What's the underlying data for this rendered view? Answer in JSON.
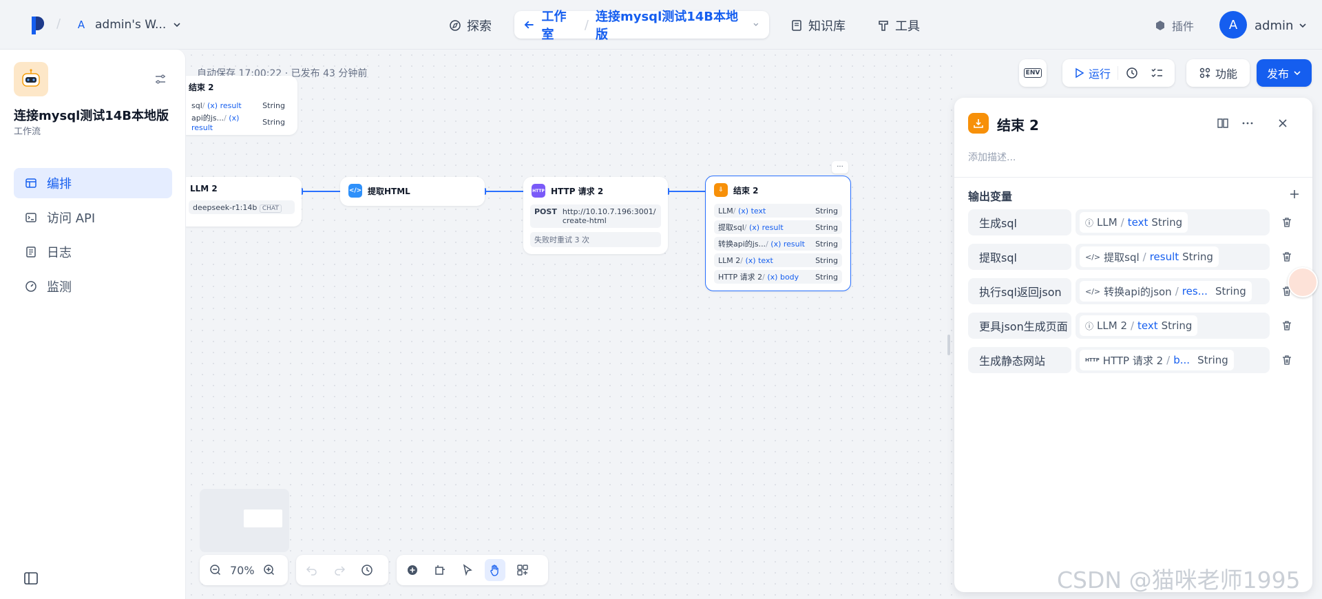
{
  "topbar": {
    "workspace_badge": "A",
    "workspace_name": "admin's W...",
    "explore": "探索",
    "studio": "工作室",
    "app_name": "连接mysql测试14B本地版",
    "knowledge": "知识库",
    "tools": "工具",
    "plugins": "插件",
    "avatar_letter": "A",
    "user": "admin"
  },
  "sidebar": {
    "app_title": "连接mysql测试14B本地版",
    "app_type": "工作流",
    "items": [
      {
        "label": "编排",
        "icon": "layout-icon"
      },
      {
        "label": "访问 API",
        "icon": "terminal-icon"
      },
      {
        "label": "日志",
        "icon": "file-list-icon"
      },
      {
        "label": "监测",
        "icon": "gauge-icon"
      }
    ]
  },
  "canvas": {
    "autosave": "自动保存 17:00:22 · 已发布 43 分钟前",
    "zoom": "70%",
    "node_end_partial": {
      "title": "结束 2",
      "rows": [
        {
          "src": "sql",
          "var": "result",
          "type": "String"
        },
        {
          "src": "api的js...",
          "var": "result",
          "type": "String"
        }
      ]
    },
    "node_llm": {
      "title": "LLM 2",
      "model": "deepseek-r1:14b",
      "tag": "CHAT"
    },
    "node_extract": {
      "title": "提取HTML"
    },
    "node_http": {
      "icon": "HTTP",
      "title": "HTTP 请求 2",
      "method": "POST",
      "url": "http://10.10.7.196:3001/create-html",
      "retry": "失败时重试 3 次"
    },
    "node_end": {
      "title": "结束 2",
      "more": "···",
      "rows": [
        {
          "src": "LLM",
          "var": "text",
          "type": "String"
        },
        {
          "src": "提取sql",
          "var": "result",
          "type": "String"
        },
        {
          "src": "转换api的js...",
          "var": "result",
          "type": "String"
        },
        {
          "src": "LLM 2",
          "var": "text",
          "type": "String"
        },
        {
          "src": "HTTP 请求 2",
          "var": "body",
          "type": "String"
        }
      ]
    }
  },
  "actions": {
    "env": "ENV",
    "run": "运行",
    "features": "功能",
    "publish": "发布"
  },
  "panel": {
    "title": "结束 2",
    "desc_placeholder": "添加描述...",
    "outputs_title": "输出变量",
    "outputs": [
      {
        "name": "生成sql",
        "src": "LLM",
        "var": "text",
        "type": "String"
      },
      {
        "name": "提取sql",
        "src": "提取sql",
        "var": "result",
        "type": "String"
      },
      {
        "name": "执行sql返回json",
        "src": "转换api的json",
        "var": "res...",
        "type": "String"
      },
      {
        "name": "更具json生成页面",
        "src": "LLM 2",
        "var": "text",
        "type": "String"
      },
      {
        "name": "生成静态网站",
        "src": "HTTP 请求 2",
        "var": "b...",
        "type": "String"
      }
    ]
  },
  "watermark": "CSDN @猫咪老师1995",
  "colors": {
    "accent": "#155eef",
    "end_node": "#f79009",
    "http_node": "#7a5af8",
    "code_node": "#2e90fa"
  }
}
